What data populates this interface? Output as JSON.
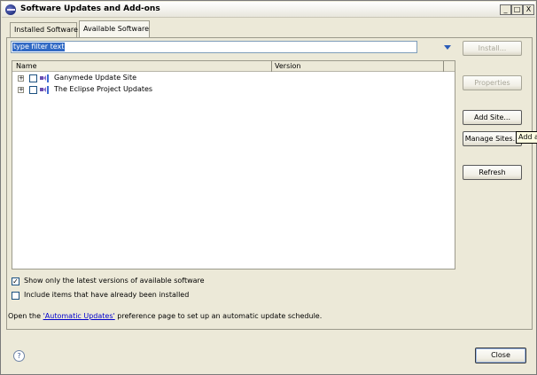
{
  "window": {
    "title": "Software Updates and Add-ons",
    "controls": {
      "minimize": "_",
      "maximize": "□",
      "close": "X"
    }
  },
  "tabs": [
    {
      "label": "Installed Software",
      "active": false
    },
    {
      "label": "Available Software",
      "active": true
    }
  ],
  "filter": {
    "value": "type filter text"
  },
  "tree": {
    "columns": [
      "Name",
      "Version"
    ],
    "rows": [
      {
        "label": "Ganymede Update Site",
        "version": "",
        "checked": false,
        "expander": "+"
      },
      {
        "label": "The Eclipse Project Updates",
        "version": "",
        "checked": false,
        "expander": "+"
      }
    ]
  },
  "buttons": {
    "install": "Install...",
    "properties": "Properties",
    "add_site": "Add Site...",
    "manage_sites": "Manage Sites...",
    "refresh": "Refresh",
    "close": "Close"
  },
  "tooltip": "Add a",
  "options": {
    "show_latest": {
      "label": "Show only the latest versions of available software",
      "checked": true,
      "mark": "✓"
    },
    "include_installed": {
      "label": "Include items that have already been installed",
      "checked": false
    }
  },
  "info": {
    "prefix": "Open the ",
    "link": "'Automatic Updates'",
    "suffix": " preference page to set up an automatic update schedule."
  },
  "help_icon_glyph": "?"
}
